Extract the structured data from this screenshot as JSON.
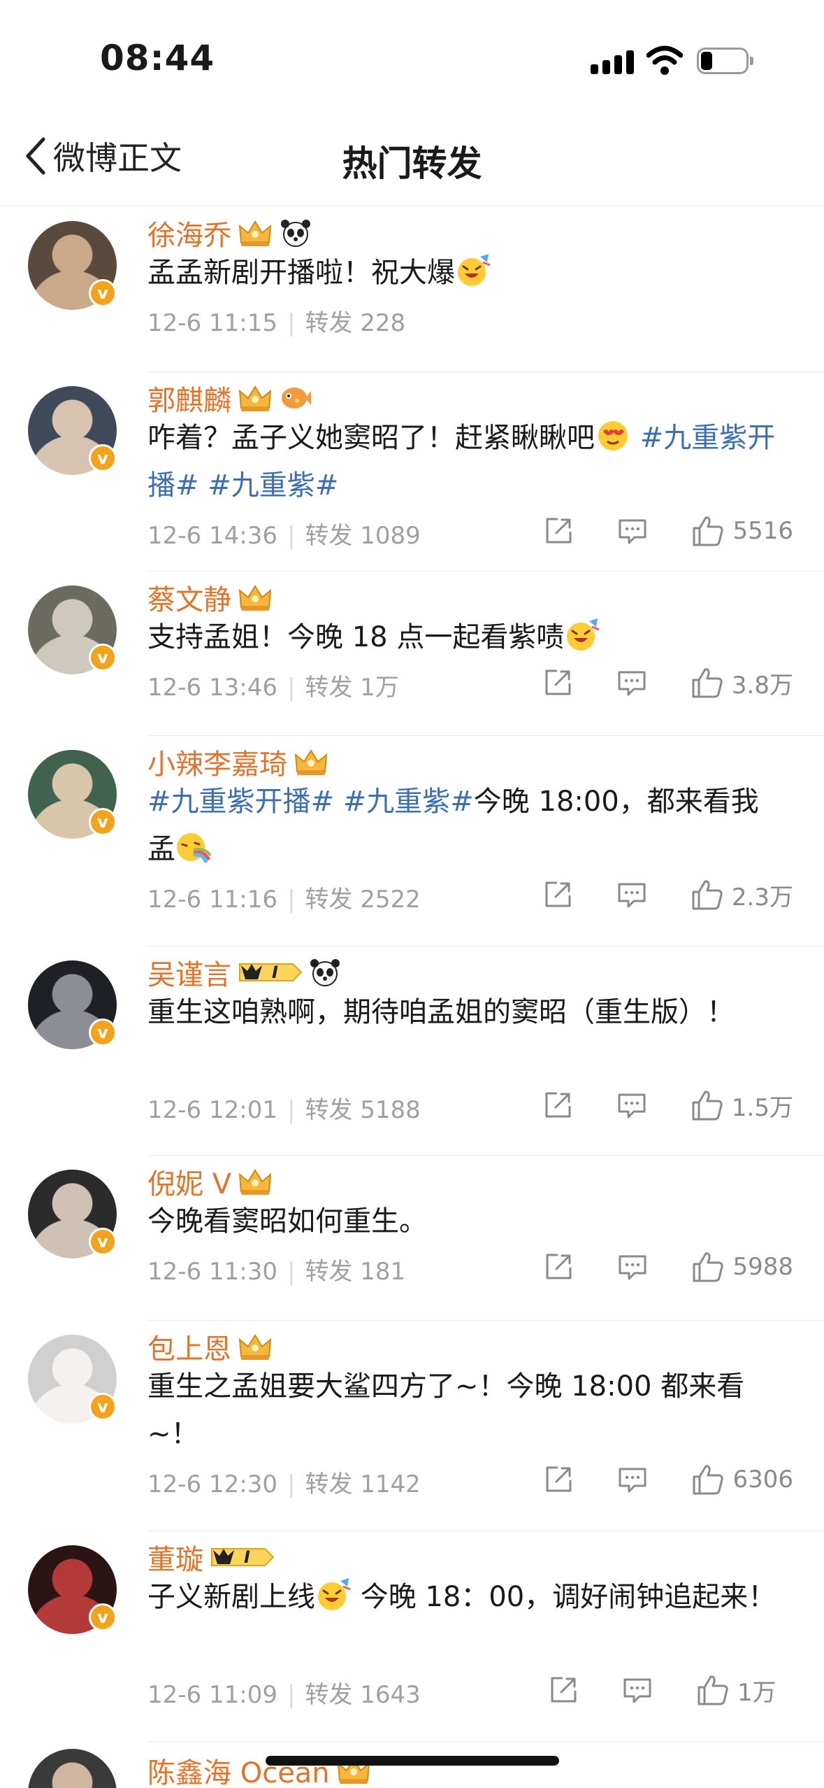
{
  "status_bar": {
    "time": "08:44"
  },
  "nav": {
    "back_label": "微博正文",
    "title": "热门转发"
  },
  "items": [
    {
      "name": "徐海乔",
      "badges": [
        "crown-icon",
        "panda-icon"
      ],
      "parts": [
        {
          "t": "孟孟新剧开播啦！祝大爆"
        }
      ],
      "emoji_after": "celebrate-emoji-icon",
      "date": "12-6 11:15",
      "repost_label": "转发",
      "repost_count": "228",
      "likes": ""
    },
    {
      "name": "郭麒麟",
      "badges": [
        "crown-icon",
        "fish-icon"
      ],
      "parts": [
        {
          "t": "咋着？孟子义她窦昭了！赶紧瞅瞅吧"
        },
        {
          "emoji": "love-emoji-icon"
        },
        {
          "t": " "
        },
        {
          "topic": "#九重紫开播#"
        },
        {
          "t": " "
        },
        {
          "topic": "#九重紫#"
        }
      ],
      "date": "12-6 14:36",
      "repost_label": "转发",
      "repost_count": "1089",
      "likes": "5516"
    },
    {
      "name": "蔡文静",
      "badges": [
        "crown-icon"
      ],
      "parts": [
        {
          "t": "支持孟姐！今晚 18 点一起看紫啧"
        },
        {
          "emoji": "celebrate-emoji-icon"
        }
      ],
      "date": "12-6 13:46",
      "repost_label": "转发",
      "repost_count": "1万",
      "likes": "3.8万"
    },
    {
      "name": "小辣李嘉琦",
      "badges": [
        "crown-icon"
      ],
      "parts": [
        {
          "topic": "#九重紫开播#"
        },
        {
          "t": " "
        },
        {
          "topic": "#九重紫#"
        },
        {
          "t": "今晚 18:00，都来看我孟"
        },
        {
          "emoji": "rainbow-emoji-icon"
        }
      ],
      "date": "12-6 11:16",
      "repost_label": "转发",
      "repost_count": "2522",
      "likes": "2.3万"
    },
    {
      "name": "吴谨言",
      "badges": [
        "vip-icon",
        "panda-icon"
      ],
      "vip_text": "I",
      "parts": [
        {
          "t": "重生这咱熟啊，期待咱孟姐的窦昭（重生版）！"
        }
      ],
      "date": "12-6 12:01",
      "repost_label": "转发",
      "repost_count": "5188",
      "likes": "1.5万"
    },
    {
      "name": "倪妮 V",
      "badges": [
        "crown-icon"
      ],
      "parts": [
        {
          "t": "今晚看窦昭如何重生。"
        }
      ],
      "date": "12-6 11:30",
      "repost_label": "转发",
      "repost_count": "181",
      "likes": "5988"
    },
    {
      "name": "包上恩",
      "badges": [
        "crown-icon"
      ],
      "parts": [
        {
          "t": "重生之孟姐要大鲨四方了~！今晚 18:00 都来看~！"
        }
      ],
      "date": "12-6 12:30",
      "repost_label": "转发",
      "repost_count": "1142",
      "likes": "6306"
    },
    {
      "name": "董璇",
      "badges": [
        "vip-icon"
      ],
      "vip_text": "I",
      "parts": [
        {
          "t": "子义新剧上线"
        },
        {
          "emoji": "celebrate-emoji-icon"
        },
        {
          "t": " 今晚 18：00，调好闹钟追起来！"
        }
      ],
      "date": "12-6 11:09",
      "repost_label": "转发",
      "repost_count": "1643",
      "likes": "1万"
    },
    {
      "name": "陈鑫海 Ocean",
      "badges": [
        "crown-icon"
      ],
      "parts": [],
      "date": "",
      "repost_label": "",
      "repost_count": "",
      "likes": ""
    }
  ],
  "colors": {
    "username": "#e1742a",
    "topic": "#3d6fae",
    "meta": "#a0a0a0",
    "badge": "#f3a21a"
  }
}
